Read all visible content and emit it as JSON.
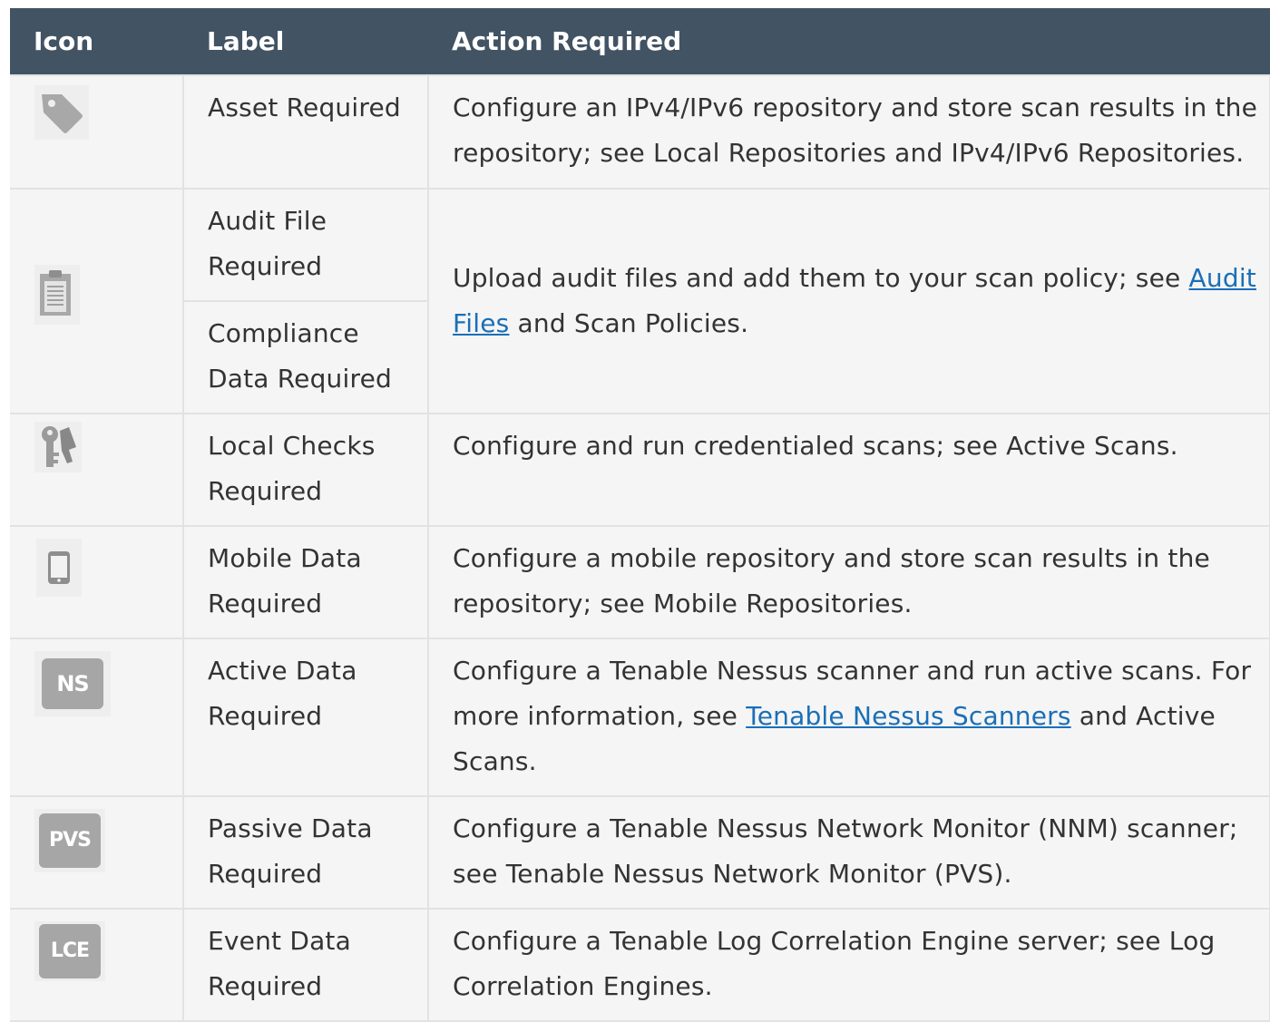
{
  "header": {
    "icon": "Icon",
    "label": "Label",
    "action": "Action Required"
  },
  "rows": [
    {
      "icon": "tag-icon",
      "label": "Asset Required",
      "action": "Configure an IPv4/IPv6 repository and store scan results in the repository; see Local Repositories and IPv4/IPv6 Repositories."
    },
    {
      "icon": "clipboard-icon",
      "label": "Audit File Required",
      "label2": "Compliance Data Required",
      "action_pre": "Upload audit files and add them to your scan policy; see ",
      "action_link": "Audit Files",
      "action_post": " and Scan Policies."
    },
    {
      "icon": "keys-icon",
      "label": "Local Checks Required",
      "action": "Configure and run credentialed scans; see Active Scans."
    },
    {
      "icon": "mobile-phone-icon",
      "label": "Mobile Data Required",
      "action": "Configure a mobile repository and store scan results in the repository; see Mobile Repositories."
    },
    {
      "icon": "ns-badge-icon",
      "badge": "NS",
      "label": "Active Data Required",
      "action_pre": "Configure a Tenable Nessus scanner and run active scans. For more information, see ",
      "action_link": "Tenable Nessus Scanners",
      "action_post": " and Active Scans."
    },
    {
      "icon": "pvs-badge-icon",
      "badge": "PVS",
      "label": "Passive Data Required",
      "action": "Configure a Tenable Nessus Network Monitor (NNM) scanner; see Tenable Nessus Network Monitor (PVS)."
    },
    {
      "icon": "lce-badge-icon",
      "badge": "LCE",
      "label": "Event Data Required",
      "action": "Configure a Tenable Log Correlation Engine server; see Log Correlation Engines."
    }
  ]
}
